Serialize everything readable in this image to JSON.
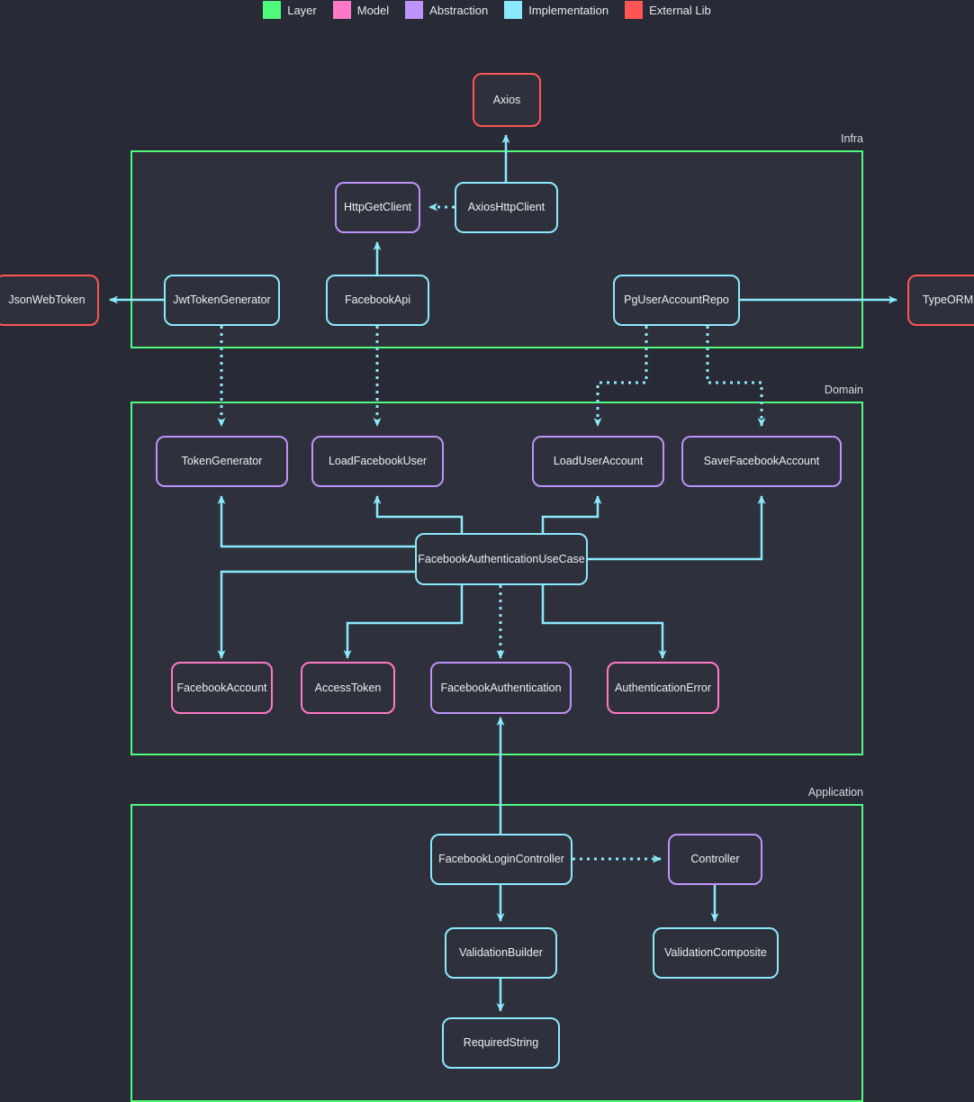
{
  "legend": {
    "items": [
      {
        "label": "Layer",
        "color": "#50fa7b",
        "key": "layer"
      },
      {
        "label": "Model",
        "color": "#ff79c6",
        "key": "model"
      },
      {
        "label": "Abstraction",
        "color": "#bd93f9",
        "key": "abstraction"
      },
      {
        "label": "Implementation",
        "color": "#8be9fd",
        "key": "implementation"
      },
      {
        "label": "External Lib",
        "color": "#ff5555",
        "key": "external"
      }
    ]
  },
  "colors": {
    "background": "#282a36",
    "layer_fill": "#2e303b",
    "layer_border": "#50fa7b",
    "model": "#ff79c6",
    "abstraction": "#bd93f9",
    "implementation": "#8be9fd",
    "external": "#ff5555",
    "text": "#eceef5"
  },
  "layers": [
    {
      "id": "infra",
      "label": "Infra"
    },
    {
      "id": "domain",
      "label": "Domain"
    },
    {
      "id": "application",
      "label": "Application"
    }
  ],
  "nodes": [
    {
      "id": "axios",
      "label": "Axios",
      "kind": "external"
    },
    {
      "id": "jsonwebtoken",
      "label": "JsonWebToken",
      "kind": "external"
    },
    {
      "id": "typeorm",
      "label": "TypeORM",
      "kind": "external"
    },
    {
      "id": "httpgetclient",
      "label": "HttpGetClient",
      "kind": "abstraction"
    },
    {
      "id": "axioshttpclient",
      "label": "AxiosHttpClient",
      "kind": "implementation"
    },
    {
      "id": "jwttokengen",
      "label": "JwtTokenGenerator",
      "kind": "implementation"
    },
    {
      "id": "facebookapi",
      "label": "FacebookApi",
      "kind": "implementation"
    },
    {
      "id": "pguseraccount",
      "label": "PgUserAccountRepo",
      "kind": "implementation"
    },
    {
      "id": "tokengenerator",
      "label": "TokenGenerator",
      "kind": "abstraction"
    },
    {
      "id": "loadfacebookuser",
      "label": "LoadFacebookUser",
      "kind": "abstraction"
    },
    {
      "id": "loaduseraccount",
      "label": "LoadUserAccount",
      "kind": "abstraction"
    },
    {
      "id": "savefacebookacc",
      "label": "SaveFacebookAccount",
      "kind": "abstraction"
    },
    {
      "id": "fbauthusecase",
      "label": "FacebookAuthenticationUseCase",
      "kind": "implementation"
    },
    {
      "id": "facebookaccount",
      "label": "FacebookAccount",
      "kind": "model"
    },
    {
      "id": "accesstoken",
      "label": "AccessToken",
      "kind": "model"
    },
    {
      "id": "fbauthentication",
      "label": "FacebookAuthentication",
      "kind": "abstraction"
    },
    {
      "id": "authenticationerr",
      "label": "AuthenticationError",
      "kind": "model"
    },
    {
      "id": "fblogincontroller",
      "label": "FacebookLoginController",
      "kind": "implementation"
    },
    {
      "id": "controller",
      "label": "Controller",
      "kind": "abstraction"
    },
    {
      "id": "validationbuilder",
      "label": "ValidationBuilder",
      "kind": "implementation"
    },
    {
      "id": "validationcomp",
      "label": "ValidationComposite",
      "kind": "implementation"
    },
    {
      "id": "requiredstring",
      "label": "RequiredString",
      "kind": "implementation"
    }
  ],
  "edges": [
    {
      "from": "axioshttpclient",
      "to": "axios",
      "style": "solid"
    },
    {
      "from": "axioshttpclient",
      "to": "httpgetclient",
      "style": "dotted"
    },
    {
      "from": "facebookapi",
      "to": "httpgetclient",
      "style": "solid"
    },
    {
      "from": "jwttokengen",
      "to": "jsonwebtoken",
      "style": "solid"
    },
    {
      "from": "pguseraccount",
      "to": "typeorm",
      "style": "solid"
    },
    {
      "from": "jwttokengen",
      "to": "tokengenerator",
      "style": "dotted"
    },
    {
      "from": "facebookapi",
      "to": "loadfacebookuser",
      "style": "dotted"
    },
    {
      "from": "pguseraccount",
      "to": "loaduseraccount",
      "style": "dotted"
    },
    {
      "from": "pguseraccount",
      "to": "savefacebookacc",
      "style": "dotted"
    },
    {
      "from": "fbauthusecase",
      "to": "tokengenerator",
      "style": "solid"
    },
    {
      "from": "fbauthusecase",
      "to": "loadfacebookuser",
      "style": "solid"
    },
    {
      "from": "fbauthusecase",
      "to": "loaduseraccount",
      "style": "solid"
    },
    {
      "from": "fbauthusecase",
      "to": "savefacebookacc",
      "style": "solid"
    },
    {
      "from": "fbauthusecase",
      "to": "facebookaccount",
      "style": "solid"
    },
    {
      "from": "fbauthusecase",
      "to": "accesstoken",
      "style": "solid"
    },
    {
      "from": "fbauthusecase",
      "to": "fbauthentication",
      "style": "dotted"
    },
    {
      "from": "fbauthusecase",
      "to": "authenticationerr",
      "style": "solid"
    },
    {
      "from": "fblogincontroller",
      "to": "fbauthentication",
      "style": "solid"
    },
    {
      "from": "fblogincontroller",
      "to": "controller",
      "style": "dotted"
    },
    {
      "from": "fblogincontroller",
      "to": "validationbuilder",
      "style": "solid"
    },
    {
      "from": "controller",
      "to": "validationcomp",
      "style": "solid"
    },
    {
      "from": "validationbuilder",
      "to": "requiredstring",
      "style": "solid"
    }
  ]
}
